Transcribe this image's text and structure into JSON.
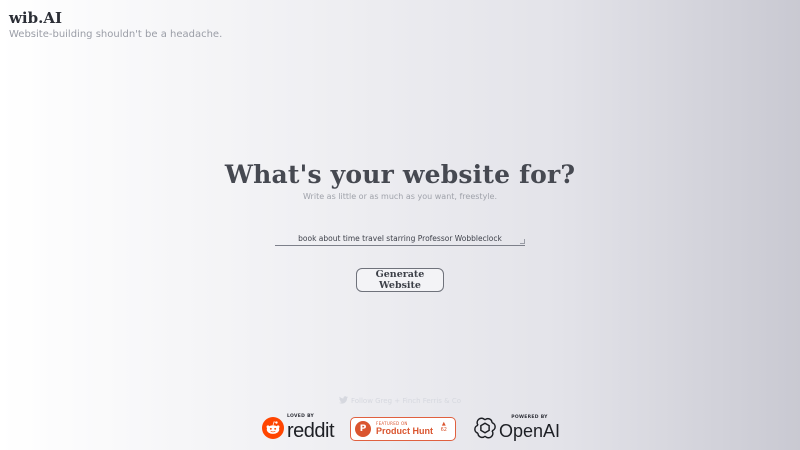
{
  "brand": {
    "title": "wib.AI",
    "tagline": "Website-building shouldn't be a headache."
  },
  "hero": {
    "heading": "What's your website for?",
    "subheading": "Write as little or as much as you want, freestyle."
  },
  "prompt": {
    "value": "book about time travel starring Professor Wobbleclock"
  },
  "generate": {
    "label": "Generate Website"
  },
  "footer": {
    "follow_text": "Follow Greg + Finch Ferris & Co",
    "badges": {
      "reddit": {
        "small": "LOVED BY",
        "word": "reddit",
        "icon": "reddit-alien-icon",
        "color": "#ff4500"
      },
      "product_hunt": {
        "small": "FEATURED ON",
        "name": "Product Hunt",
        "logo_letter": "P",
        "votes": "62",
        "icon": "upvote-triangle-icon",
        "color": "#da552f"
      },
      "openai": {
        "small": "POWERED BY",
        "word": "OpenAI",
        "icon": "openai-knot-icon"
      }
    }
  },
  "colors": {
    "heading": "#464951",
    "brand_orange": "#da552f",
    "reddit_orange": "#ff4500"
  }
}
